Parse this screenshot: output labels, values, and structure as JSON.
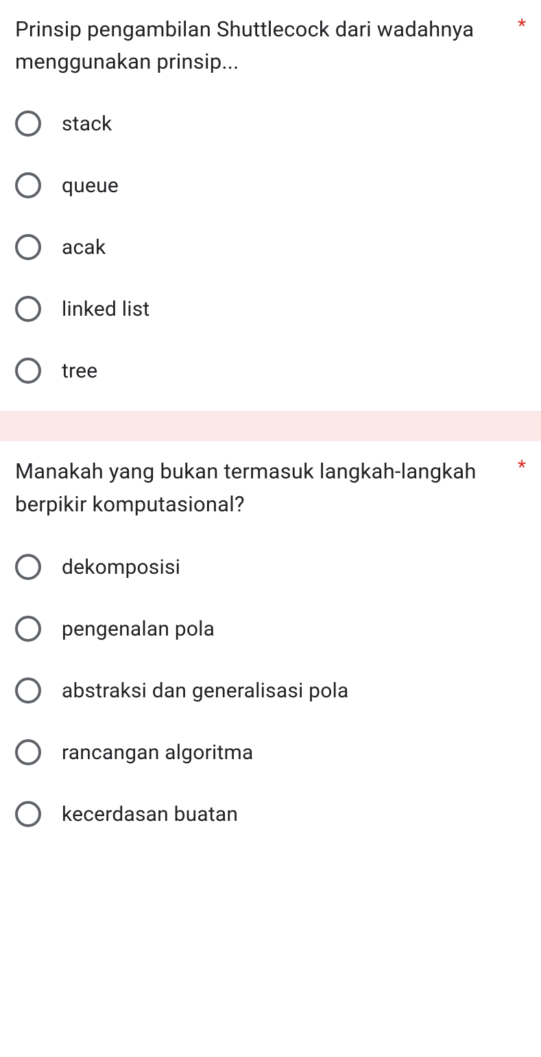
{
  "questions": [
    {
      "text": "Prinsip pengambilan Shuttlecock dari wadahnya menggunakan prinsip...",
      "required": "*",
      "options": [
        "stack",
        "queue",
        "acak",
        "linked list",
        "tree"
      ]
    },
    {
      "text": "Manakah yang bukan termasuk langkah-langkah berpikir komputasional?",
      "required": "*",
      "options": [
        "dekomposisi",
        "pengenalan pola",
        "abstraksi dan generalisasi pola",
        "rancangan algoritma",
        "kecerdasan buatan"
      ]
    }
  ]
}
